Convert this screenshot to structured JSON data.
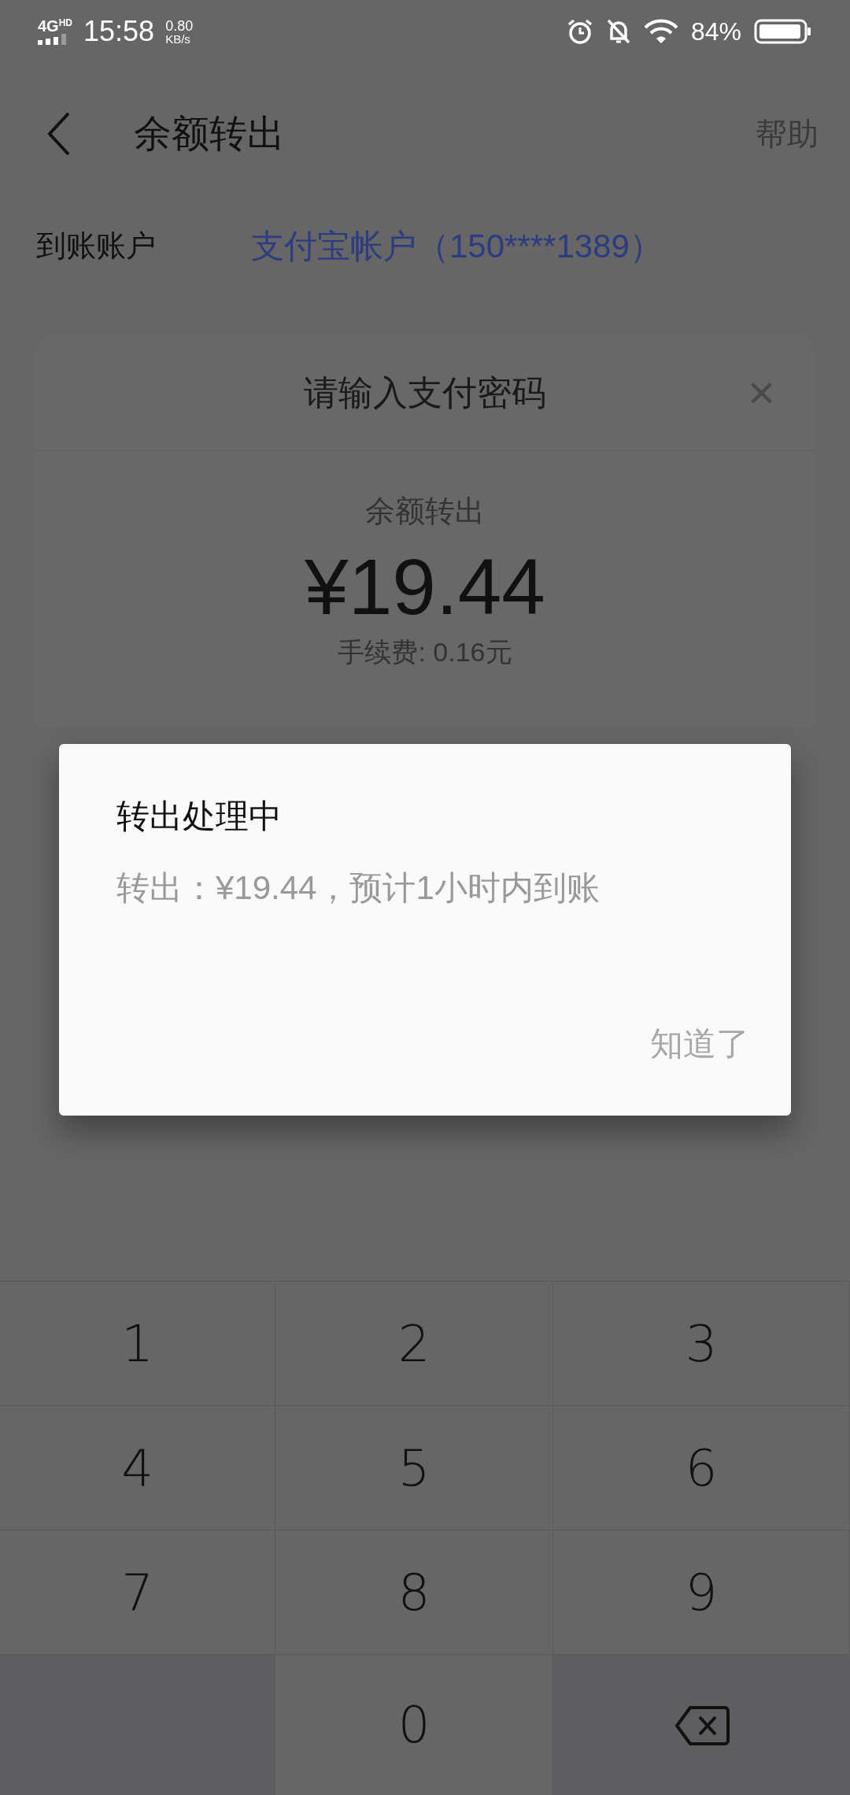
{
  "status_bar": {
    "network": "4G",
    "network_badge": "HD",
    "time": "15:58",
    "speed_value": "0.80",
    "speed_unit": "KB/s",
    "battery": "84%"
  },
  "header": {
    "title": "余额转出",
    "help": "帮助"
  },
  "account_row": {
    "label": "到账账户",
    "value": "支付宝帐户（150****1389）"
  },
  "password_sheet": {
    "title": "请输入支付密码",
    "close": "×",
    "subtitle": "余额转出",
    "amount": "¥19.44",
    "fee": "手续费: 0.16元"
  },
  "dialog": {
    "title": "转出处理中",
    "message": "转出：¥19.44，预计1小时内到账",
    "button": "知道了"
  },
  "keypad": [
    {
      "kind": "digit",
      "label": "1"
    },
    {
      "kind": "digit",
      "label": "2"
    },
    {
      "kind": "digit",
      "label": "3"
    },
    {
      "kind": "digit",
      "label": "4"
    },
    {
      "kind": "digit",
      "label": "5"
    },
    {
      "kind": "digit",
      "label": "6"
    },
    {
      "kind": "digit",
      "label": "7"
    },
    {
      "kind": "digit",
      "label": "8"
    },
    {
      "kind": "digit",
      "label": "9"
    },
    {
      "kind": "blank"
    },
    {
      "kind": "digit",
      "label": "0"
    },
    {
      "kind": "delete"
    }
  ]
}
